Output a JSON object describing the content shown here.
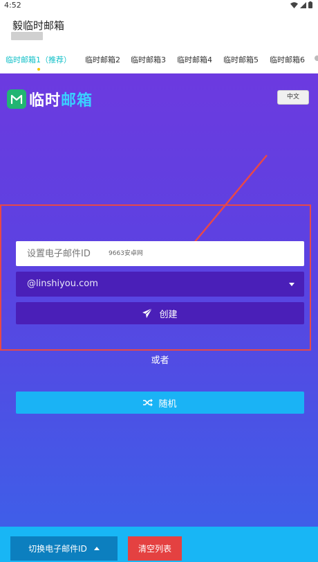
{
  "status": {
    "time": "4:52"
  },
  "app": {
    "title": "毅临时邮箱"
  },
  "tabs": [
    {
      "label": "临时邮箱1（推荐）"
    },
    {
      "label": "临时邮箱2"
    },
    {
      "label": "临时邮箱3"
    },
    {
      "label": "临时邮箱4"
    },
    {
      "label": "临时邮箱5"
    },
    {
      "label": "临时邮箱6"
    }
  ],
  "logo": {
    "text_white": "临时",
    "text_cyan": "邮箱"
  },
  "language_button": "中文",
  "form": {
    "email_placeholder": "设置电子邮件ID",
    "watermark": "9663安卓网",
    "domain_selected": "@linshiyou.com",
    "create_label": "创建",
    "or_label": "或者",
    "random_label": "随机"
  },
  "footer": {
    "switch_label": "切换电子邮件ID",
    "clear_label": "清空列表"
  },
  "colors": {
    "accent_tab": "#12c0c8",
    "gradient_top": "#6c3ae0",
    "gradient_bottom": "#3f5ee8",
    "primary_button": "#4a1fb8",
    "random_button": "#1ab3f5",
    "footer": "#18b6f5",
    "clear_button": "#e44141",
    "annotation_red": "#e84848"
  }
}
